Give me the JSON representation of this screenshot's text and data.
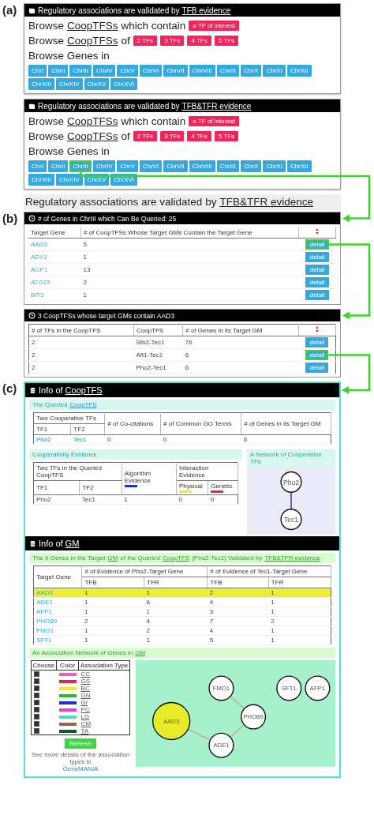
{
  "panel_labels": [
    "(a)",
    "(b)",
    "(c)"
  ],
  "browse_panels": [
    {
      "title": "Regulatory associations are validated by",
      "title_link": "TFB evidence",
      "tf_line": {
        "prefix": "Browse",
        "link": "CoopTFSs",
        "suffix": "which contain",
        "button": "a TF of interest"
      },
      "size_line": {
        "prefix": "Browse",
        "link": "CoopTFSs",
        "suffix": "of",
        "buttons": [
          "2 TFs",
          "3 TFs",
          "4 TFs",
          "5 TFs"
        ]
      },
      "genes_line": {
        "text": "Browse Genes in",
        "chromosomes": [
          {
            "label": "ChrI",
            "selected": false
          },
          {
            "label": "ChrII",
            "selected": false
          },
          {
            "label": "ChrIII",
            "selected": false
          },
          {
            "label": "ChrIV",
            "selected": false
          },
          {
            "label": "ChrV",
            "selected": false
          },
          {
            "label": "ChrVI",
            "selected": false
          },
          {
            "label": "ChrVII",
            "selected": false
          },
          {
            "label": "ChrVIII",
            "selected": false
          },
          {
            "label": "ChrIX",
            "selected": false
          },
          {
            "label": "ChrX",
            "selected": false
          },
          {
            "label": "ChrXI",
            "selected": false
          },
          {
            "label": "ChrXII",
            "selected": false
          },
          {
            "label": "ChrXIII",
            "selected": false
          },
          {
            "label": "ChrXIV",
            "selected": false
          },
          {
            "label": "ChrXV",
            "selected": false
          },
          {
            "label": "ChrXVI",
            "selected": false
          }
        ]
      }
    },
    {
      "title": "Regulatory associations are validated by",
      "title_link": "TFB&TFR evidence",
      "tf_line": {
        "prefix": "Browse",
        "link": "CoopTFSs",
        "suffix": "which contain",
        "button": "a TF of interest"
      },
      "size_line": {
        "prefix": "Browse",
        "link": "CoopTFSs",
        "suffix": "of",
        "buttons": [
          "2 TFs",
          "3 TFs",
          "4 TFs",
          "5 TFs"
        ]
      },
      "genes_line": {
        "text": "Browse Genes in",
        "chromosomes": [
          {
            "label": "ChrI",
            "selected": false
          },
          {
            "label": "ChrII",
            "selected": false
          },
          {
            "label": "ChrIII",
            "selected": true
          },
          {
            "label": "ChrIV",
            "selected": false
          },
          {
            "label": "ChrV",
            "selected": false
          },
          {
            "label": "ChrVI",
            "selected": false
          },
          {
            "label": "ChrVII",
            "selected": false
          },
          {
            "label": "ChrVIII",
            "selected": false
          },
          {
            "label": "ChrIX",
            "selected": false
          },
          {
            "label": "ChrX",
            "selected": false
          },
          {
            "label": "ChrXI",
            "selected": false
          },
          {
            "label": "ChrXII",
            "selected": false
          },
          {
            "label": "ChrXIII",
            "selected": false
          },
          {
            "label": "ChrXIV",
            "selected": false
          },
          {
            "label": "ChrXV",
            "selected": false
          },
          {
            "label": "ChrXVI",
            "selected": false
          }
        ]
      }
    }
  ],
  "results_heading": {
    "text": "Regulatory associations are validated by",
    "link": "TFB&TFR evidence"
  },
  "genes_table": {
    "title": "# of Genes in ChrIII which Can Be Queried: 25",
    "columns": [
      "Target Gene",
      "# of CoopTFSs Whose Target GMs Contain the Target Gene"
    ],
    "rows": [
      {
        "gene": "AAD3",
        "count": "5",
        "action": "detail",
        "selected": true
      },
      {
        "gene": "ADY2",
        "count": "1",
        "action": "detail",
        "selected": false
      },
      {
        "gene": "AGP1",
        "count": "13",
        "action": "detail",
        "selected": false
      },
      {
        "gene": "ATG15",
        "count": "2",
        "action": "detail",
        "selected": false
      },
      {
        "gene": "BIT2",
        "count": "1",
        "action": "detail",
        "selected": false
      }
    ]
  },
  "coop_table": {
    "title": "3 CoopTFSs whose target GMs contain AAD3",
    "columns": [
      "# of TFs in the CoopTFS",
      "CoopTFS",
      "# of Genes in its Target GM"
    ],
    "rows": [
      {
        "tfs": "2",
        "cooptfs": "Stb2-Tec1",
        "genes": "76",
        "action": "detail",
        "selected": false
      },
      {
        "tfs": "2",
        "cooptfs": "Aft1-Tec1",
        "genes": "6",
        "action": "detail",
        "selected": true
      },
      {
        "tfs": "2",
        "cooptfs": "Pho2-Tec1",
        "genes": "6",
        "action": "detail",
        "selected": false
      }
    ]
  },
  "coop_info": {
    "title": "Info of",
    "link": "CoopTFS",
    "queried": {
      "title": "The Queried",
      "link": "CoopTFS",
      "group": "Two Cooperative TFs",
      "sub": [
        "TF1",
        "TF2"
      ],
      "columns": [
        "# of Co-citations",
        "# of Common GO Terms",
        "# of Genes in its Target GM"
      ],
      "row": [
        "Pho2",
        "Tec1",
        "0",
        "0",
        "6"
      ]
    },
    "evidence": {
      "title": "Cooperativity Evidence",
      "group": "Two TFs in the Queried CoopTFS",
      "sub": [
        "TF1",
        "TF2"
      ],
      "algorithm": {
        "label": "Algorithm Evidence",
        "color": "#1a2fd6"
      },
      "interaction": {
        "label": "Interaction Evidence",
        "types": [
          {
            "label": "Physical",
            "color": "#f0f020"
          },
          {
            "label": "Genetic",
            "color": "#e8264a"
          }
        ]
      },
      "row": [
        "Pho2",
        "Tec1",
        "1",
        "0",
        "0"
      ]
    },
    "network": {
      "title": "A Network of Cooperative TFs",
      "nodes": [
        "Pho2",
        "Tec1"
      ]
    }
  },
  "gm_info": {
    "title": "Info of",
    "link": "GM",
    "genes": {
      "title_parts": [
        {
          "text": "The 6 Genes in the Target",
          "link": false
        },
        {
          "text": "GM",
          "link": true
        },
        {
          "text": "of the Queried",
          "link": false
        },
        {
          "text": "CoopTFS",
          "link": true
        },
        {
          "text": "(Pho2-Tec1) Validated by",
          "link": false
        },
        {
          "text": "TFB&TFR evidence",
          "link": true
        }
      ],
      "first_column": "Target Gene",
      "groups": [
        "# of Evidence of Pho2-Target Gene",
        "# of Evidence of Tec1-Target Gene"
      ],
      "sub": [
        "TFB",
        "TFR",
        "TFB",
        "TFR"
      ],
      "rows": [
        {
          "gene": "AAD3",
          "values": [
            "1",
            "1",
            "2",
            "1"
          ],
          "selected": true
        },
        {
          "gene": "ADE1",
          "values": [
            "1",
            "6",
            "4",
            "1"
          ],
          "selected": false
        },
        {
          "gene": "AFP1",
          "values": [
            "1",
            "1",
            "3",
            "1"
          ],
          "selected": false
        },
        {
          "gene": "PHO89",
          "values": [
            "2",
            "4",
            "7",
            "2"
          ],
          "selected": false
        },
        {
          "gene": "FMO1",
          "values": [
            "1",
            "2",
            "4",
            "1"
          ],
          "selected": false
        },
        {
          "gene": "SFT1",
          "values": [
            "1",
            "1",
            "5",
            "1"
          ],
          "selected": false
        }
      ]
    },
    "association": {
      "title": "An Association Network of Genes in",
      "link": "GM",
      "legend_columns": [
        "Choose",
        "Color",
        "Association Type"
      ],
      "types": [
        {
          "label": "CC",
          "color": "#f060b0",
          "checked": true
        },
        {
          "label": "GS",
          "color": "#e8264a",
          "checked": true
        },
        {
          "label": "BC",
          "color": "#f0f020",
          "checked": true
        },
        {
          "label": "GN",
          "color": "#2db82d",
          "checked": true
        },
        {
          "label": "GI",
          "color": "#1a2fd6",
          "checked": true
        },
        {
          "label": "PC",
          "color": "#e040e0",
          "checked": true
        },
        {
          "label": "LG",
          "color": "#40e0c0",
          "checked": true
        },
        {
          "label": "CM",
          "color": "#a0624a",
          "checked": true
        },
        {
          "label": "TA",
          "color": "#0e5a30",
          "checked": true
        }
      ],
      "button": "Refresh",
      "note": "See more details of the association types in",
      "note_link": "GeneMANIA",
      "nodes": [
        {
          "label": "FMO1",
          "selected": false
        },
        {
          "label": "SFT1",
          "selected": false
        },
        {
          "label": "AFP1",
          "selected": false
        },
        {
          "label": "AAD3",
          "selected": true
        },
        {
          "label": "PHO89",
          "selected": false
        },
        {
          "label": "ADE1",
          "selected": false
        }
      ]
    }
  }
}
